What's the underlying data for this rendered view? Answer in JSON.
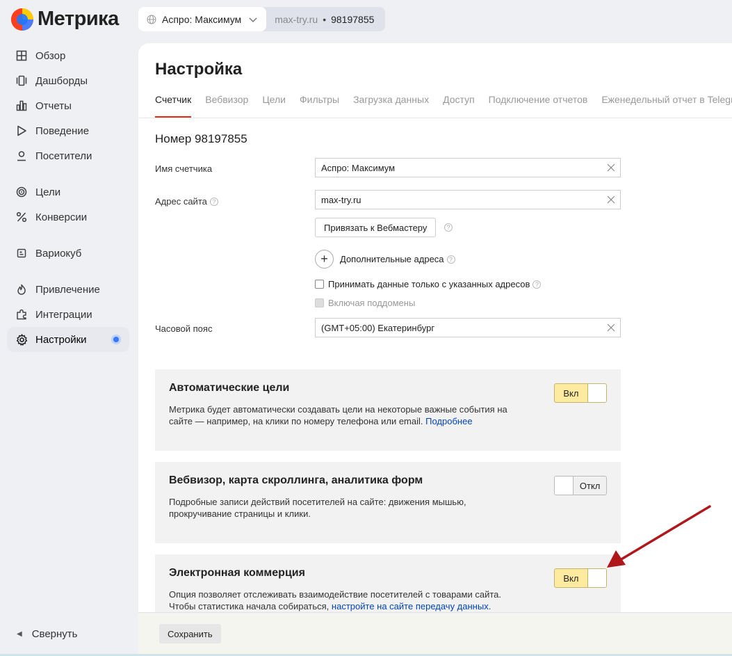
{
  "app": {
    "name": "Метрика"
  },
  "counter": {
    "name": "Аспро: Максимум",
    "site": "max-try.ru",
    "number": "98197855"
  },
  "sidebar": {
    "items": [
      {
        "label": "Обзор",
        "icon": "grid-icon"
      },
      {
        "label": "Дашборды",
        "icon": "dashboards-icon"
      },
      {
        "label": "Отчеты",
        "icon": "bar-chart-icon"
      },
      {
        "label": "Поведение",
        "icon": "play-icon"
      },
      {
        "label": "Посетители",
        "icon": "user-icon"
      },
      {
        "label": "Цели",
        "icon": "target-icon"
      },
      {
        "label": "Конверсии",
        "icon": "percent-icon"
      },
      {
        "label": "Вариокуб",
        "icon": "cube-icon"
      },
      {
        "label": "Привлечение",
        "icon": "flame-icon"
      },
      {
        "label": "Интеграции",
        "icon": "puzzle-icon"
      },
      {
        "label": "Настройки",
        "icon": "gear-icon"
      }
    ],
    "collapse_label": "Свернуть"
  },
  "page": {
    "title": "Настройка",
    "tabs": [
      "Счетчик",
      "Вебвизор",
      "Цели",
      "Фильтры",
      "Загрузка данных",
      "Доступ",
      "Подключение отчетов",
      "Еженедельный отчет в Telegram"
    ],
    "counter_title": "Номер 98197855"
  },
  "form": {
    "name_label": "Имя счетчика",
    "name_value": "Аспро: Максимум",
    "site_label": "Адрес сайта",
    "site_value": "max-try.ru",
    "webmaster_button": "Привязать к Вебмастеру",
    "extra_addresses": "Дополнительные адреса",
    "only_listed": "Принимать данные только с указанных адресов",
    "subdomains": "Включая поддомены",
    "timezone_label": "Часовой пояс",
    "timezone_value": "(GMT+05:00) Екатеринбург"
  },
  "cards": {
    "auto_goals": {
      "title": "Автоматические цели",
      "desc": "Метрика будет автоматически создавать цели на некоторые важные события на сайте — например, на клики по номеру телефона или email.",
      "link": "Подробнее",
      "toggle": "Вкл"
    },
    "webvisor": {
      "title": "Вебвизор, карта скроллинга, аналитика форм",
      "desc": "Подробные записи действий посетителей на сайте: движения мышью, прокручивание страницы и клики.",
      "toggle": "Откл"
    },
    "ecommerce": {
      "title": "Электронная коммерция",
      "desc": "Опция позволяет отслеживать взаимодействие посетителей с товарами сайта. Чтобы статистика начала собираться,",
      "link": "настройте на сайте передачу данных.",
      "toggle": "Вкл"
    }
  },
  "footer": {
    "save_label": "Сохранить"
  },
  "colors": {
    "accent": "#e9261b",
    "toggle_on": "#ffeba0",
    "link": "#0044bb",
    "arrow": "#b0171b"
  }
}
